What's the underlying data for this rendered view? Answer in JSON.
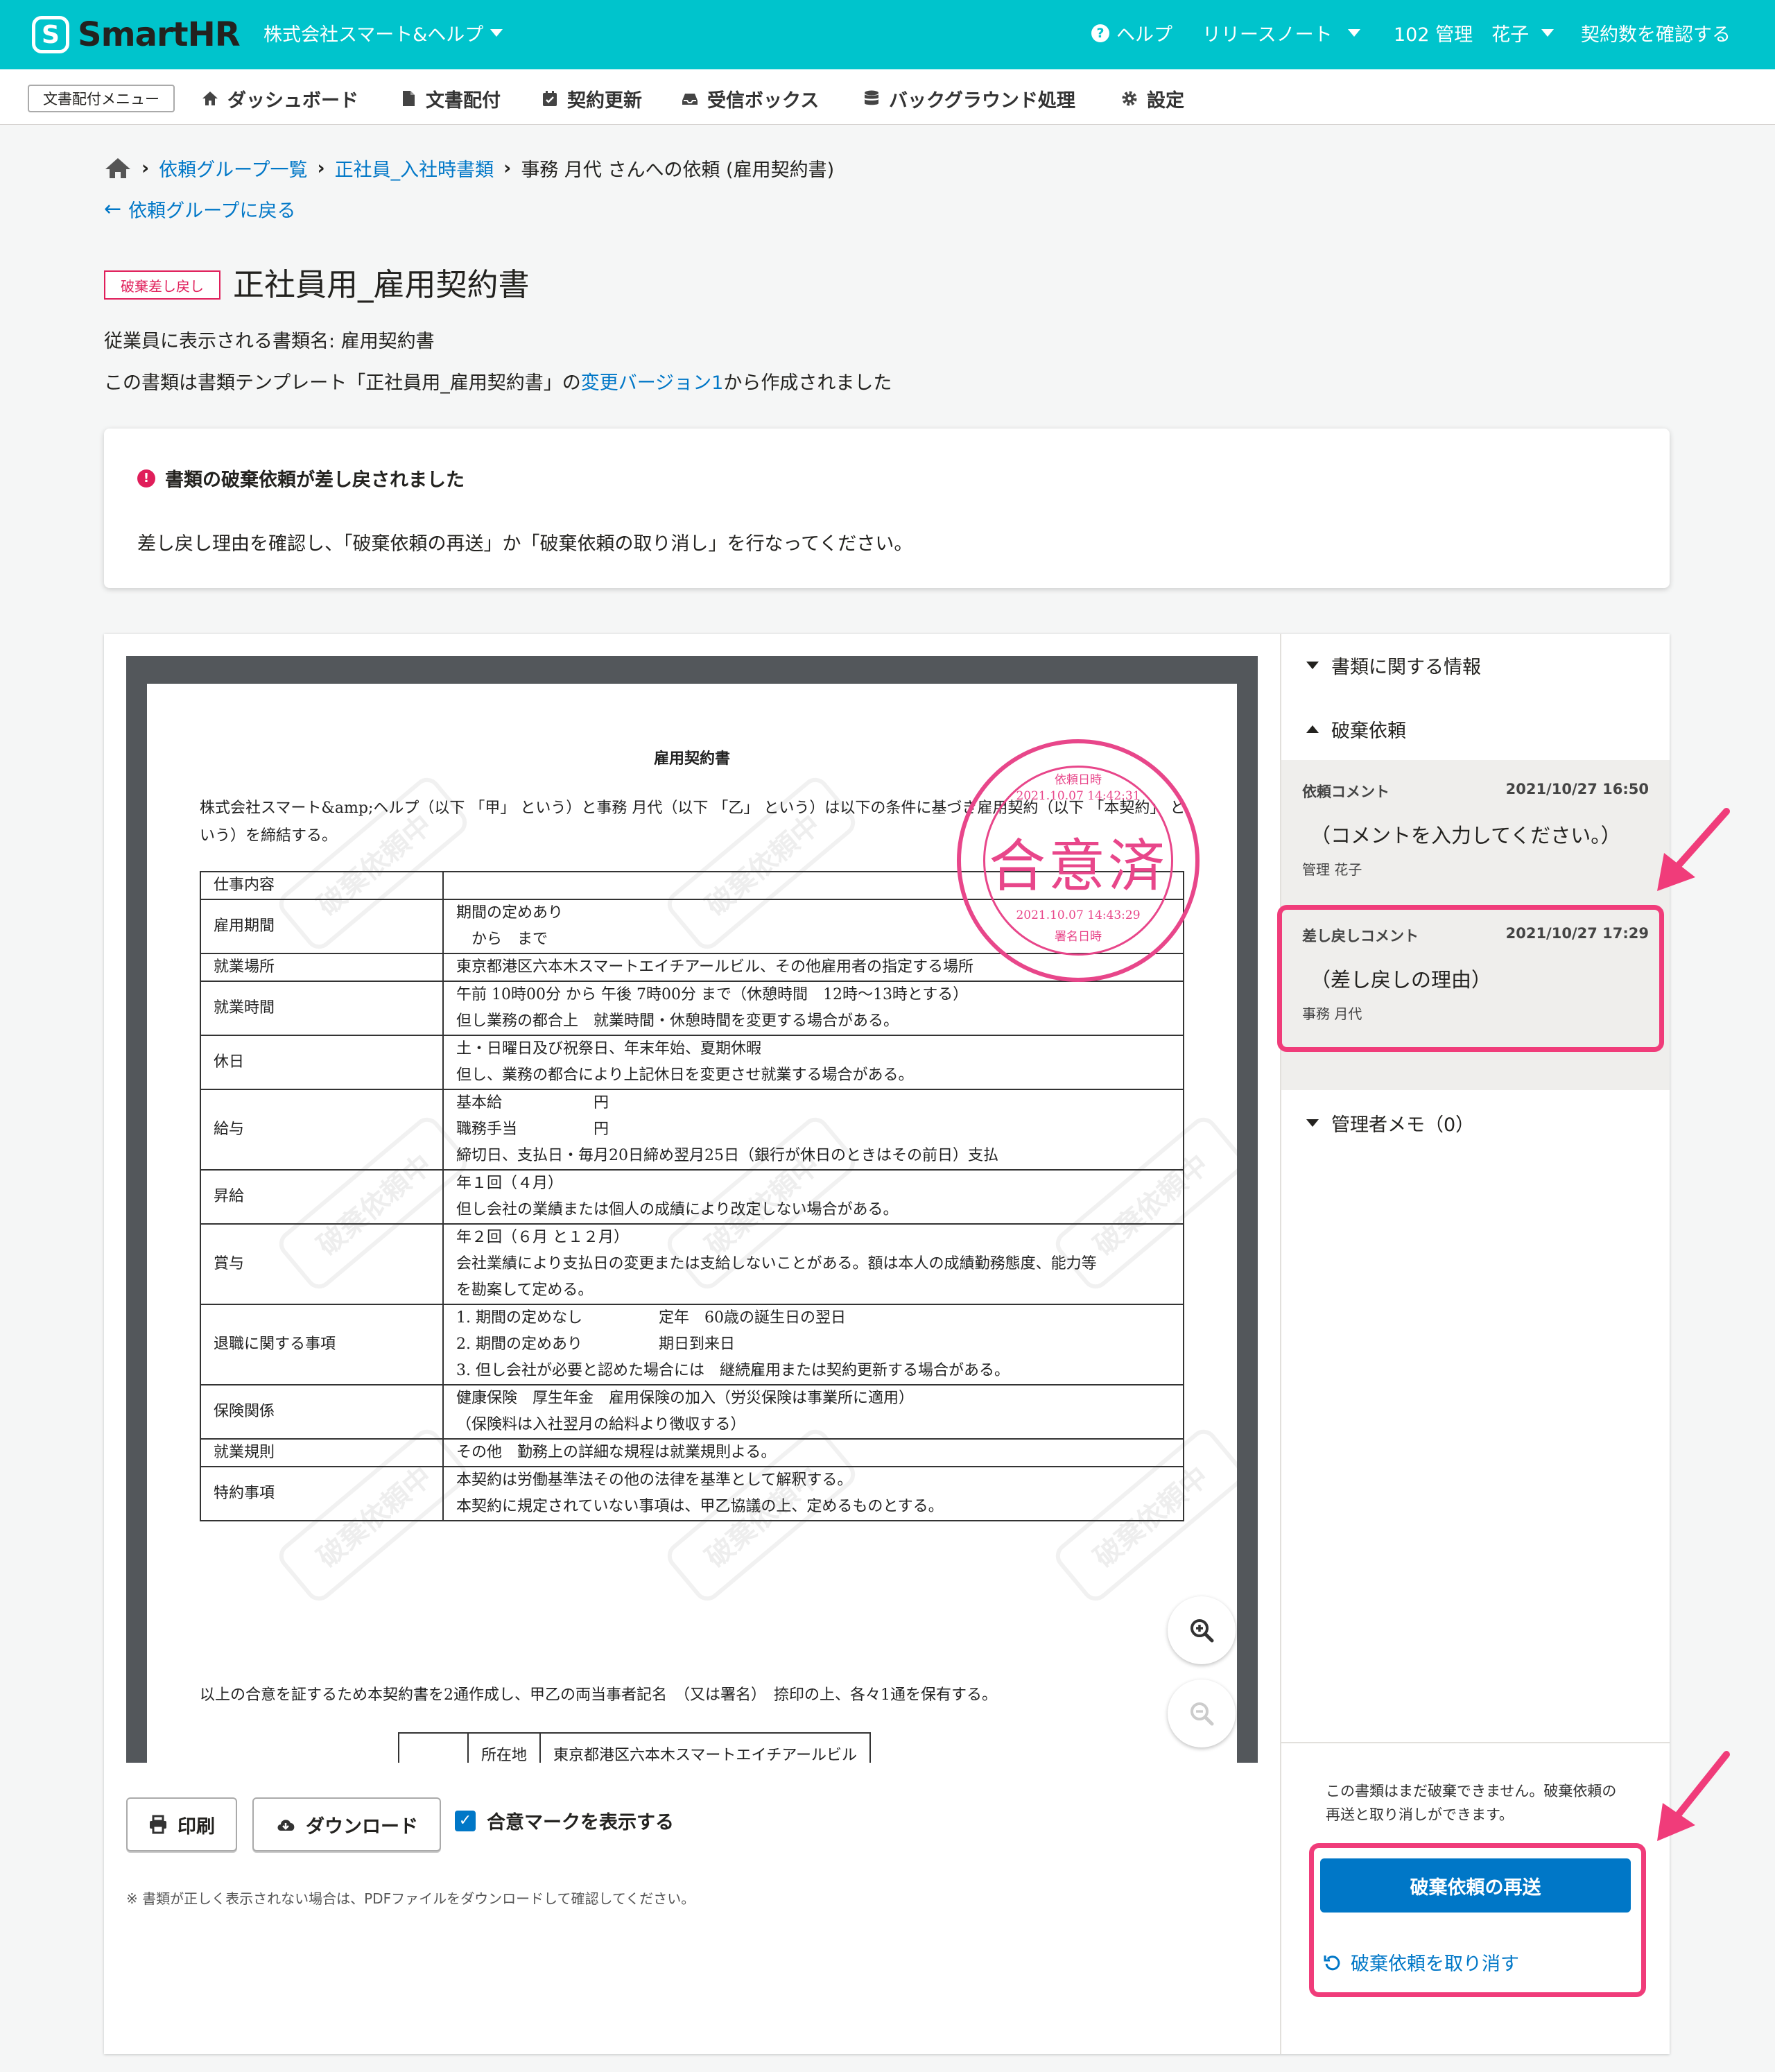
{
  "header": {
    "logo_icon": "S",
    "logo_text": "SmartHR",
    "company": "株式会社スマート&ヘルプ",
    "help": "ヘルプ",
    "release_notes": "リリースノート",
    "user": "102 管理　花子",
    "contract": "契約数を確認する"
  },
  "subnav": {
    "menu": "文書配付メニュー",
    "items": [
      {
        "label": "ダッシュボード",
        "icon": "dashboard-icon"
      },
      {
        "label": "文書配付",
        "icon": "document-icon"
      },
      {
        "label": "契約更新",
        "icon": "calendar-icon"
      },
      {
        "label": "受信ボックス",
        "icon": "inbox-icon"
      },
      {
        "label": "バックグラウンド処理",
        "icon": "database-icon"
      },
      {
        "label": "設定",
        "icon": "gear-icon"
      }
    ]
  },
  "breadcrumb": {
    "items": [
      "依頼グループ一覧",
      "正社員_入社時書類"
    ],
    "current": "事務 月代 さんへの依頼 (雇用契約書)"
  },
  "back_link": "依頼グループに戻る",
  "status_badge": "破棄差し戻し",
  "title": "正社員用_雇用契約書",
  "info": {
    "display_name": "従業員に表示される書類名: 雇用契約書",
    "template_prefix": "この書類は書類テンプレート「正社員用_雇用契約書」の",
    "template_link": "変更バージョン1",
    "template_suffix": "から作成されました"
  },
  "alert": {
    "title": "書類の破棄依頼が差し戻されました",
    "body": "差し戻し理由を確認し、「破棄依頼の再送」か「破棄依頼の取り消し」を行なってください。"
  },
  "document": {
    "title": "雇用契約書",
    "intro": "株式会社スマート&amp;ヘルプ（以下 「甲」 という）と事務 月代（以下 「乙」 という）は以下の条件に基づき雇用契約（以下 「本契約」 という）を締結する。",
    "rows": [
      {
        "key": "仕事内容",
        "lines": [
          ""
        ]
      },
      {
        "key": "雇用期間",
        "lines": [
          "期間の定めあり",
          "　から　まで"
        ]
      },
      {
        "key": "就業場所",
        "lines": [
          "東京都港区六本木スマートエイチアールビル、その他雇用者の指定する場所"
        ]
      },
      {
        "key": "就業時間",
        "lines": [
          "午前 10時00分 から 午後 7時00分 まで（休憩時間　12時〜13時とする）",
          "但し業務の都合上　就業時間・休憩時間を変更する場合がある。"
        ]
      },
      {
        "key": "休日",
        "lines": [
          "土・日曜日及び祝祭日、年末年始、夏期休暇",
          "但し、業務の都合により上記休日を変更させ就業する場合がある。"
        ]
      },
      {
        "key": "給与",
        "lines": [
          "基本給　　　　　　円",
          "職務手当　　　　　円",
          "締切日、支払日・毎月20日締め翌月25日（銀行が休日のときはその前日）支払"
        ]
      },
      {
        "key": "昇給",
        "lines": [
          "年１回（４月）",
          "但し会社の業績または個人の成績により改定しない場合がある。"
        ]
      },
      {
        "key": "賞与",
        "lines": [
          "年２回（６月 と１２月）",
          "会社業績により支払日の変更または支給しないことがある。額は本人の成績勤務態度、能力等",
          "を勘案して定める。"
        ]
      },
      {
        "key": "退職に関する事項",
        "lines": [
          "1. 期間の定めなし　　　　　定年　60歳の誕生日の翌日",
          "2. 期間の定めあり　　　　　期日到来日",
          "3. 但し会社が必要と認めた場合には　継続雇用または契約更新する場合がある。"
        ]
      },
      {
        "key": "保険関係",
        "lines": [
          "健康保険　厚生年金　雇用保険の加入（労災保険は事業所に適用）",
          "（保険料は入社翌月の給料より徴収する）"
        ]
      },
      {
        "key": "就業規則",
        "lines": [
          "その他　勤務上の詳細な規程は就業規則よる。"
        ]
      },
      {
        "key": "特約事項",
        "lines": [
          "本契約は労働基準法その他の法律を基準として解釈する。",
          "本契約に規定されていない事項は、甲乙協議の上、定めるものとする。"
        ]
      }
    ],
    "footer": "以上の合意を証するため本契約書を2通作成し、甲乙の両当事者記名　（又は署名）　捺印の上、各々1通を保有する。",
    "sign_label": "所在地",
    "sign_value": "東京都港区六本木スマートエイチアールビル",
    "watermark": "破棄依頼中",
    "stamp": {
      "requested_label": "依頼日時",
      "requested_at": "2021.10.07 14:42:31",
      "text": "合意済",
      "signed_at": "2021.10.07 14:43:29",
      "signed_label": "署名日時",
      "color": "#e8468a"
    }
  },
  "viewer_actions": {
    "print": "印刷",
    "download": "ダウンロード",
    "show_mark": "合意マークを表示する",
    "show_mark_checked": true,
    "note": "※ 書類が正しく表示されない場合は、PDFファイルをダウンロードして確認してください。"
  },
  "side": {
    "doc_info": "書類に関する情報",
    "discard_request": "破棄依頼",
    "request_comment": {
      "label": "依頼コメント",
      "time": "2021/10/27 16:50",
      "body": "（コメントを入力してください。）",
      "author": "管理 花子"
    },
    "return_comment": {
      "label": "差し戻しコメント",
      "time": "2021/10/27 17:29",
      "body": "（差し戻しの理由）",
      "author": "事務 月代"
    },
    "admin_memo": "管理者メモ（0）",
    "cannot_discard_note": "この書類はまだ破棄できません。破棄依頼の再送と取り消しができます。",
    "resend_button": "破棄依頼の再送",
    "cancel_link": "破棄依頼を取り消す"
  },
  "colors": {
    "header": "#00c4cc",
    "link": "#0077c7",
    "danger": "#e01e5a",
    "highlight": "#f03c7a"
  }
}
